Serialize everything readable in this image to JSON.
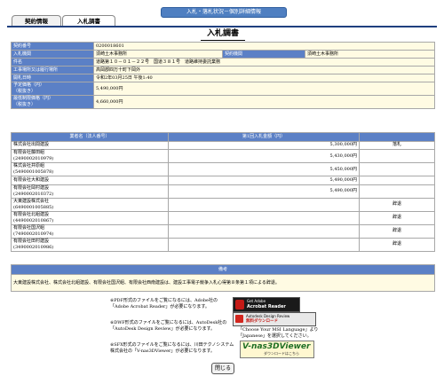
{
  "header": {
    "window_title": "入札・落札状況－個別詳細情報"
  },
  "tabs": [
    {
      "label": "契約情報"
    },
    {
      "label": "入札調書"
    }
  ],
  "page_title": "入札調書",
  "info": {
    "contract_no_label": "契約番号",
    "contract_no": "0200018601",
    "org_label": "入札機関",
    "org": "須崎土木事務所",
    "contract_org_label": "契約機関",
    "contract_org": "須崎土木事務所",
    "name_label": "件名",
    "name": "道路第１０－０１－２２号　国道３８１号　道路維持委託業務",
    "place_label": "工事場所又は履行場所",
    "place": "高岡郡四万十町下岡外",
    "open_date_label": "開札日時",
    "open_date": "令和2年03月25日 午後1:40",
    "est_price_label": "予定価格（円）\n（税抜き）",
    "est_price": "5,490,000円",
    "min_price_label": "最低制限価格（円）\n（税抜き）",
    "min_price": "4,660,000円"
  },
  "bids": {
    "col_name": "業者名（法人番号）",
    "col_amount": "第1回入札金額（円）",
    "rows": [
      {
        "name": "株式会社出間建設",
        "amount": "5,300,000円",
        "result": "落札"
      },
      {
        "name": "有限会社藤田組\n(2490002010979)",
        "amount": "5,430,000円",
        "result": ""
      },
      {
        "name": "株式会社井原組\n(5490001005878)",
        "amount": "5,450,000円",
        "result": ""
      },
      {
        "name": "有限会社大和建設",
        "amount": "5,490,000円",
        "result": ""
      },
      {
        "name": "有限会社岡村建設\n(2490002010372)",
        "amount": "5,490,000円",
        "result": ""
      },
      {
        "name": "大東建設株式会社\n(6490001005885)",
        "amount": "",
        "result": "辞退"
      },
      {
        "name": "有限会社北組建設\n(4490002010867)",
        "amount": "",
        "result": "辞退"
      },
      {
        "name": "有限会社国沢組\n(7490002010974)",
        "amount": "",
        "result": "辞退"
      },
      {
        "name": "有限会社田村建設\n(3490002010986)",
        "amount": "",
        "result": "辞退"
      }
    ]
  },
  "remarks": {
    "label": "備考",
    "text": "大東建設株式会社、株式会社北組建設、有限会社国沢組、有限会社西南建設は、建設工事電子競争入札心得第８条第１項による辞退。"
  },
  "notes": {
    "pdf": "※PDF形式のファイルをご覧になるには、Adobe社の「Adobe Acrobat Reader」が必要になります。",
    "dwf": "※DWF形式のファイルをご覧になるには、AutoDesk社の「AutoDesk Design Review」が必要になります。",
    "sfx": "※SFX形式のファイルをご覧になるには、川田テクノシステム株式会社の「V-nas3DViewer」が必要になります。",
    "dwf_tip": "「Choose Your MSI Language」より\n「Japanese」を選択してください。"
  },
  "badges": {
    "acrobat_line1": "Get Adobe",
    "acrobat_line2": "Acrobat Reader",
    "autodesk_line1": "Autodesk Design Review",
    "autodesk_line2": "無料ダウンロード",
    "vnas_line1": "V-nas3DViewer",
    "vnas_line2": "ダウンロードはこちら"
  },
  "close_label": "閉じる"
}
